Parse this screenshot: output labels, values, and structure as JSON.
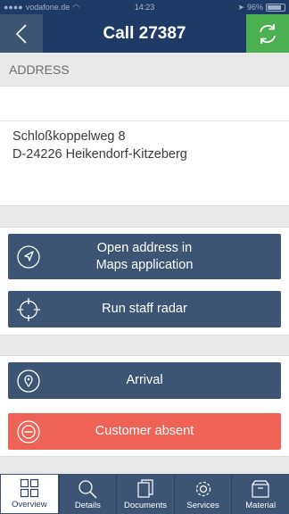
{
  "status_bar": {
    "carrier": "vodafone.de",
    "time": "14:23",
    "battery": "96%"
  },
  "header": {
    "title": "Call 27387",
    "back_icon": "chevron-left-icon",
    "sync_icon": "sync-icon"
  },
  "address": {
    "section_label": "ADDRESS",
    "street": "Schloßkoppelweg 8",
    "city": "D-24226 Heikendorf-Kitzeberg"
  },
  "actions": {
    "open_maps": "Open address in\nMaps application",
    "staff_radar": "Run staff radar"
  },
  "status_actions": {
    "arrival": "Arrival",
    "customer_absent": "Customer absent"
  },
  "tabs": [
    {
      "label": "Overview",
      "icon": "grid-icon",
      "active": true
    },
    {
      "label": "Details",
      "icon": "search-icon",
      "active": false
    },
    {
      "label": "Documents",
      "icon": "documents-icon",
      "active": false
    },
    {
      "label": "Services",
      "icon": "gear-icon",
      "active": false
    },
    {
      "label": "Material",
      "icon": "box-icon",
      "active": false
    }
  ],
  "colors": {
    "navy": "#1e3a66",
    "slate": "#3e5474",
    "green": "#4caf50",
    "red": "#ee6356",
    "background": "#e9e9e9"
  }
}
